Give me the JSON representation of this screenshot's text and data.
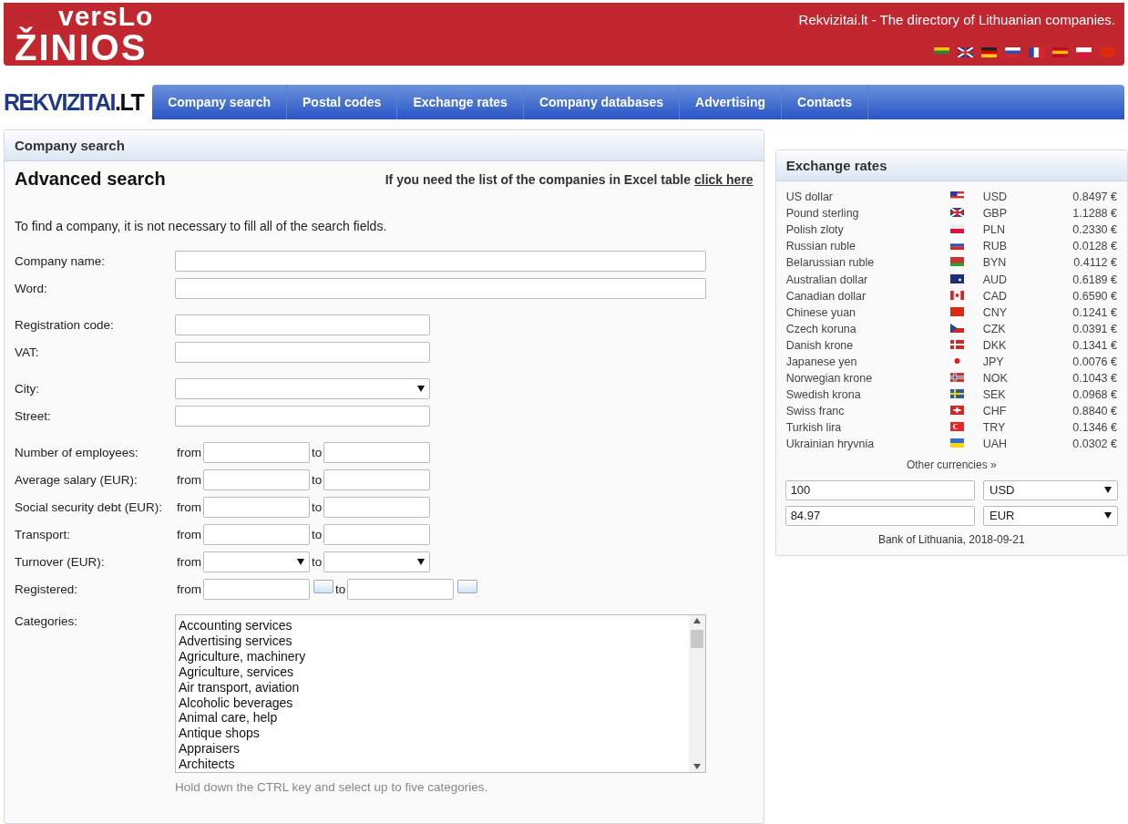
{
  "header": {
    "logo_top": "versLo",
    "logo_bottom": "ŽINIOS",
    "tagline": "Rekvizitai.lt - The directory of Lithuanian companies."
  },
  "brand": {
    "name": "REKVIZITAI",
    "suffix": ".LT"
  },
  "nav": [
    "Company search",
    "Postal codes",
    "Exchange rates",
    "Company databases",
    "Advertising",
    "Contacts"
  ],
  "search_panel": {
    "title": "Company search",
    "heading": "Advanced search",
    "excel_note": "If you need the list of the companies in Excel table",
    "excel_link": "click here",
    "intro": "To find a company, it is not necessary to fill all of the search fields.",
    "groups": [
      [
        {
          "label": "Company name:",
          "kind": "wide"
        },
        {
          "label": "Word:",
          "kind": "wide"
        }
      ],
      [
        {
          "label": "Registration code:",
          "kind": "medium"
        },
        {
          "label": "VAT:",
          "kind": "medium"
        }
      ],
      [
        {
          "label": "City:",
          "kind": "select"
        },
        {
          "label": "Street:",
          "kind": "medium"
        }
      ],
      [
        {
          "label": "Number of employees:",
          "kind": "range",
          "from": "from",
          "to": "to"
        },
        {
          "label": "Average salary (EUR):",
          "kind": "range",
          "from": "from",
          "to": "to"
        },
        {
          "label": "Social security debt (EUR):",
          "kind": "range",
          "from": "from",
          "to": "to"
        },
        {
          "label": "Transport:",
          "kind": "range",
          "from": "from",
          "to": "to"
        },
        {
          "label": "Turnover (EUR):",
          "kind": "range-select",
          "from": "from",
          "to": "to"
        },
        {
          "label": "Registered:",
          "kind": "date-range",
          "from": "from",
          "to": "to"
        }
      ]
    ],
    "categories_label": "Categories:",
    "categories": [
      "Accounting services",
      "Advertising services",
      "Agriculture, machinery",
      "Agriculture, services",
      "Air transport, aviation",
      "Alcoholic beverages",
      "Animal care, help",
      "Antique shops",
      "Appraisers",
      "Architects"
    ],
    "categories_hint": "Hold down the CTRL key and select up to five categories."
  },
  "rates_panel": {
    "title": "Exchange rates",
    "rows": [
      {
        "name": "US dollar",
        "code": "USD",
        "rate": "0.8497 €"
      },
      {
        "name": "Pound sterling",
        "code": "GBP",
        "rate": "1.1288 €"
      },
      {
        "name": "Polish zloty",
        "code": "PLN",
        "rate": "0.2330 €"
      },
      {
        "name": "Russian ruble",
        "code": "RUB",
        "rate": "0.0128 €"
      },
      {
        "name": "Belarussian ruble",
        "code": "BYN",
        "rate": "0.4112 €"
      },
      {
        "name": "Australian dollar",
        "code": "AUD",
        "rate": "0.6189 €"
      },
      {
        "name": "Canadian dollar",
        "code": "CAD",
        "rate": "0.6590 €"
      },
      {
        "name": "Chinese yuan",
        "code": "CNY",
        "rate": "0.1241 €"
      },
      {
        "name": "Czech koruna",
        "code": "CZK",
        "rate": "0.0391 €"
      },
      {
        "name": "Danish krone",
        "code": "DKK",
        "rate": "0.1341 €"
      },
      {
        "name": "Japanese yen",
        "code": "JPY",
        "rate": "0.0076 €"
      },
      {
        "name": "Norwegian krone",
        "code": "NOK",
        "rate": "0.1043 €"
      },
      {
        "name": "Swedish krona",
        "code": "SEK",
        "rate": "0.0968 €"
      },
      {
        "name": "Swiss franc",
        "code": "CHF",
        "rate": "0.8840 €"
      },
      {
        "name": "Turkish lira",
        "code": "TRY",
        "rate": "0.1346 €"
      },
      {
        "name": "Ukrainian hryvnia",
        "code": "UAH",
        "rate": "0.0302 €"
      }
    ],
    "other_link": "Other currencies »",
    "converter": [
      {
        "amount": "100",
        "currency": "USD"
      },
      {
        "amount": "84.97",
        "currency": "EUR"
      }
    ],
    "source": "Bank of Lithuania, 2018-09-21"
  }
}
